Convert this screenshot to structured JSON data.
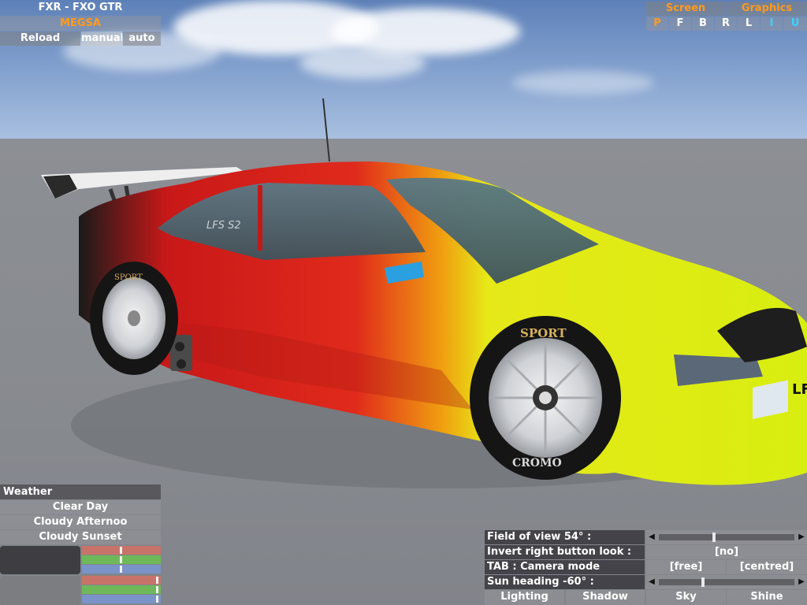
{
  "viewer": {
    "car_name": "FXR - FXO GTR",
    "mode": "MEGSA",
    "buttons": {
      "reload": "Reload",
      "manual": "manual",
      "auto": "auto"
    }
  },
  "top_right": {
    "screen_label": "Screen",
    "graphics_label": "Graphics",
    "views": [
      "P",
      "F",
      "B",
      "R",
      "L",
      "I",
      "U"
    ]
  },
  "weather": {
    "header": "Weather",
    "options": [
      "Clear Day",
      "Cloudy Afternoo",
      "Cloudy Sunset"
    ]
  },
  "colors": {
    "orange": "#ff9a1e",
    "cyan": "#37d6ff",
    "bar_red": "#c8736a",
    "bar_green": "#6fb85a",
    "bar_blue": "#7a93c9"
  },
  "options": {
    "fov_label": "Field of view 54° :",
    "invert_label": "Invert right button look :",
    "invert_value": "[no]",
    "tab_label": "TAB : Camera mode",
    "camera_free": "[free]",
    "camera_centred": "[centred]",
    "sun_label": "Sun heading -60° :",
    "tabs": [
      "Lighting",
      "Shadow",
      "Sky",
      "Shine"
    ]
  },
  "car_decals": {
    "window": "LFS S2",
    "tyre_brand": "SPORT",
    "tyre_brand2": "CROMO",
    "plate": "LFS"
  }
}
